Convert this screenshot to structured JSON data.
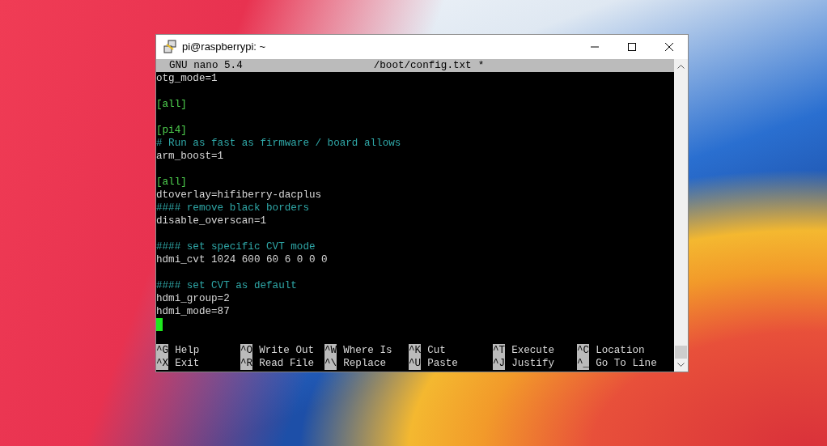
{
  "window": {
    "title": "pi@raspberrypi: ~"
  },
  "nano": {
    "version": "GNU nano 5.4",
    "filename": "/boot/config.txt",
    "modified_mark": "*"
  },
  "lines": [
    {
      "kind": "text",
      "text": "otg_mode=1"
    },
    {
      "kind": "blank"
    },
    {
      "kind": "section",
      "text": "[all]"
    },
    {
      "kind": "blank"
    },
    {
      "kind": "section",
      "text": "[pi4]"
    },
    {
      "kind": "comment",
      "text": "# Run as fast as firmware / board allows"
    },
    {
      "kind": "text",
      "text": "arm_boost=1"
    },
    {
      "kind": "blank"
    },
    {
      "kind": "section",
      "text": "[all]"
    },
    {
      "kind": "text",
      "text": "dtoverlay=hifiberry-dacplus"
    },
    {
      "kind": "comment",
      "text": "#### remove black borders"
    },
    {
      "kind": "text",
      "text": "disable_overscan=1"
    },
    {
      "kind": "blank"
    },
    {
      "kind": "comment",
      "text": "#### set specific CVT mode"
    },
    {
      "kind": "text",
      "text": "hdmi_cvt 1024 600 60 6 0 0 0"
    },
    {
      "kind": "blank"
    },
    {
      "kind": "comment",
      "text": "#### set CVT as default"
    },
    {
      "kind": "text",
      "text": "hdmi_group=2"
    },
    {
      "kind": "text",
      "text": "hdmi_mode=87"
    },
    {
      "kind": "cursor"
    }
  ],
  "shortcuts": [
    [
      {
        "key": "^G",
        "label": "Help"
      },
      {
        "key": "^O",
        "label": "Write Out"
      },
      {
        "key": "^W",
        "label": "Where Is"
      },
      {
        "key": "^K",
        "label": "Cut"
      },
      {
        "key": "^T",
        "label": "Execute"
      },
      {
        "key": "^C",
        "label": "Location"
      }
    ],
    [
      {
        "key": "^X",
        "label": "Exit"
      },
      {
        "key": "^R",
        "label": "Read File"
      },
      {
        "key": "^\\",
        "label": "Replace"
      },
      {
        "key": "^U",
        "label": "Paste"
      },
      {
        "key": "^J",
        "label": "Justify"
      },
      {
        "key": "^_",
        "label": "Go To Line"
      }
    ]
  ]
}
